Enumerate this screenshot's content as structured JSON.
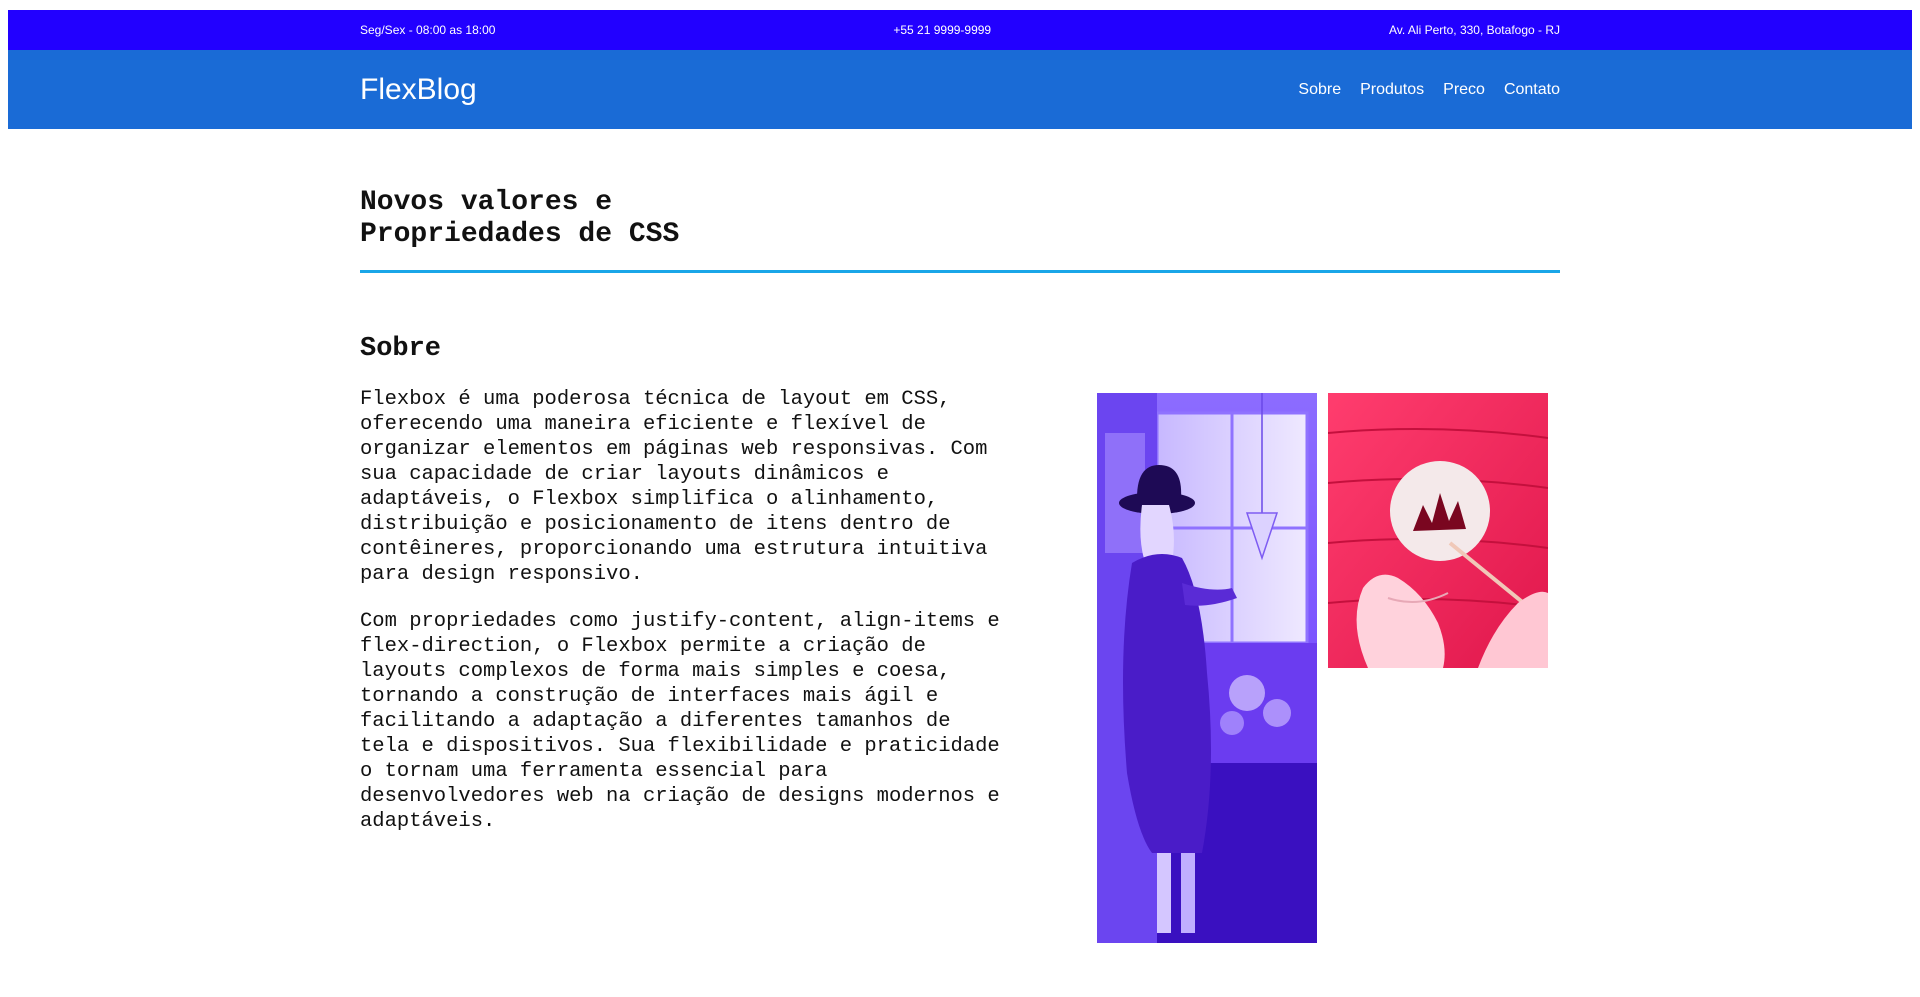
{
  "topbar": {
    "hours": "Seg/Sex - 08:00 as 18:00",
    "phone": "+55 21 9999-9999",
    "address": "Av. Ali Perto, 330, Botafogo - RJ"
  },
  "navbar": {
    "logo": "FlexBlog",
    "links": [
      "Sobre",
      "Produtos",
      "Preco",
      "Contato"
    ]
  },
  "main": {
    "title_line1": "Novos valores e",
    "title_line2": "Propriedades de CSS",
    "section_heading": "Sobre",
    "paragraphs": [
      "Flexbox é uma poderosa técnica de layout em CSS, oferecendo uma maneira eficiente e flexível de organizar elementos em páginas web responsivas. Com sua capacidade de criar layouts dinâmicos e adaptáveis, o Flexbox simplifica o alinhamento, distribuição e posicionamento de itens dentro de contêineres, proporcionando uma estrutura intuitiva para design responsivo.",
      "Com propriedades como justify-content, align-items e flex-direction, o Flexbox permite a criação de layouts complexos de forma mais simples e coesa, tornando a construção de interfaces mais ágil e facilitando a adaptação a diferentes tamanhos de tela e dispositivos. Sua flexibilidade e praticidade o tornam uma ferramenta essencial para desenvolvedores web na criação de designs modernos e adaptáveis."
    ]
  },
  "colors": {
    "topbar_bg": "#2200ff",
    "navbar_bg": "#1a6bd6",
    "title_rule": "#19a6e8",
    "image1_tint": "#6a3dff",
    "image2_tint": "#ff2a5f"
  }
}
